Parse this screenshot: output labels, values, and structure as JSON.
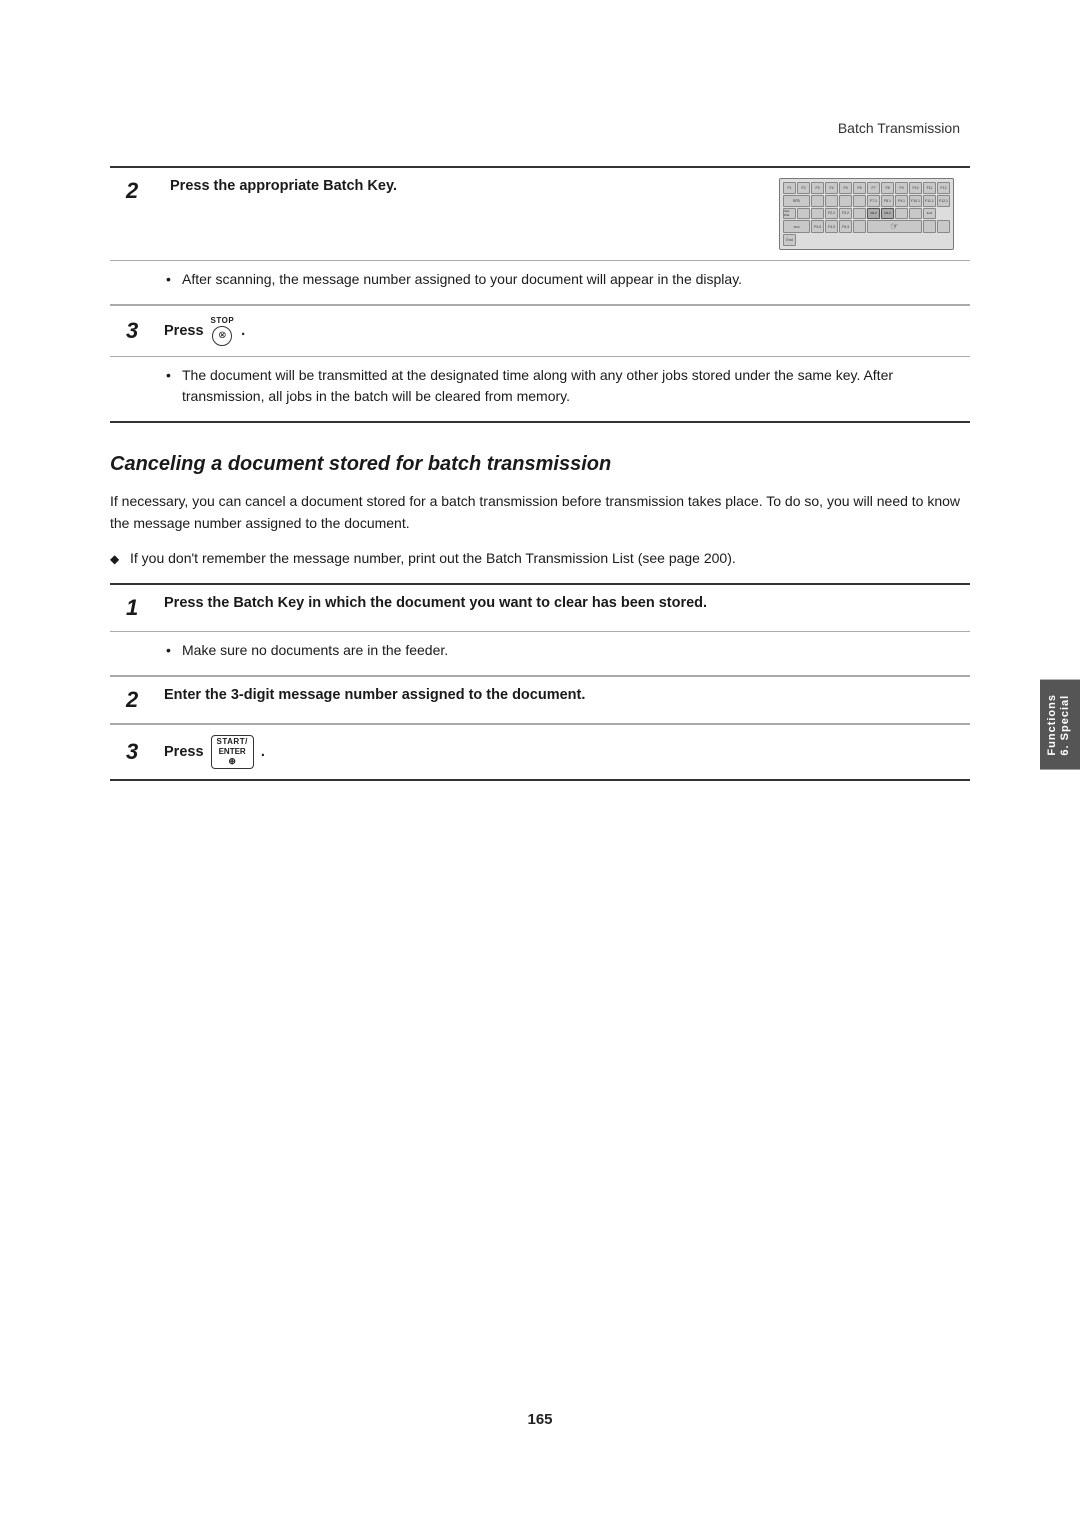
{
  "page": {
    "header": "Batch Transmission",
    "page_number": "165",
    "sidebar_tab_line1": "6. Special",
    "sidebar_tab_line2": "Functions"
  },
  "steps_section1": [
    {
      "number": "2",
      "instruction": "Press the appropriate Batch Key.",
      "has_image": true,
      "bullet": "After scanning, the message number assigned to your document will appear in the display."
    },
    {
      "number": "3",
      "instruction_prefix": "Press",
      "key_label": "STOP",
      "instruction_suffix": ".",
      "bullet": "The document will be transmitted at the designated time along with any other jobs stored under the same key. After transmission, all jobs in the batch will be cleared from memory."
    }
  ],
  "section_heading": "Canceling a document stored for batch transmission",
  "intro_para": "If necessary, you can cancel a document stored for a batch transmission before transmission takes place. To do so, you will need to know the message number assigned to the document.",
  "diamond_bullet": "If you don't remember the message number, print out the Batch Transmission List (see page 200).",
  "steps_section2": [
    {
      "number": "1",
      "instruction": "Press the Batch Key in which the document you want to clear has been stored.",
      "bullet": "Make sure no documents are in the feeder."
    },
    {
      "number": "2",
      "instruction": "Enter the 3-digit message number assigned to the document.",
      "bullet": null
    },
    {
      "number": "3",
      "instruction_prefix": "Press",
      "key_label_top": "START/",
      "key_label_bottom": "ENTER",
      "instruction_suffix": ".",
      "bullet": null
    }
  ]
}
